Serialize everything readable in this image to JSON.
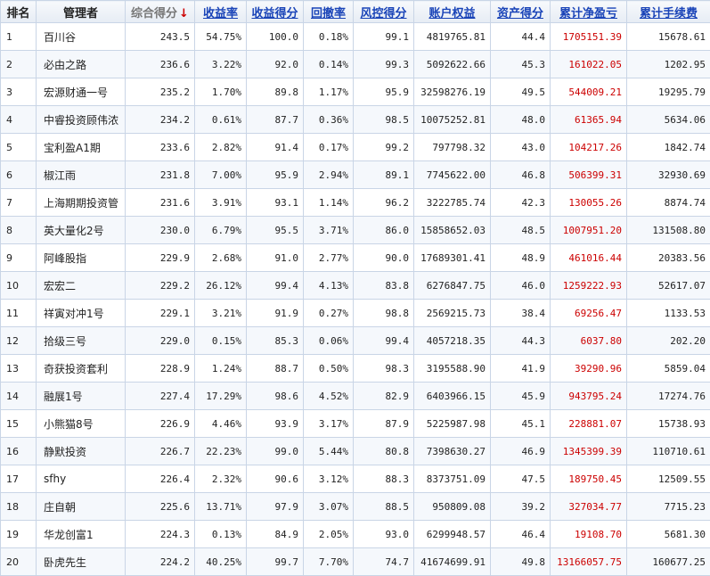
{
  "headers": {
    "rank": "排名",
    "manager": "管理者",
    "composite": "综合得分",
    "sort_arrow": "↓",
    "return_rate": "收益率",
    "return_score": "收益得分",
    "drawdown": "回撤率",
    "risk_score": "风控得分",
    "equity": "账户权益",
    "asset_score": "资产得分",
    "cum_pnl": "累计净盈亏",
    "cum_fee": "累计手续费"
  },
  "rows": [
    {
      "rank": "1",
      "manager": "百川谷",
      "composite": "243.5",
      "return_rate": "54.75%",
      "return_score": "100.0",
      "drawdown": "0.18%",
      "risk_score": "99.1",
      "equity": "4819765.81",
      "asset_score": "44.4",
      "cum_pnl": "1705151.39",
      "cum_fee": "15678.61"
    },
    {
      "rank": "2",
      "manager": "必由之路",
      "composite": "236.6",
      "return_rate": "3.22%",
      "return_score": "92.0",
      "drawdown": "0.14%",
      "risk_score": "99.3",
      "equity": "5092622.66",
      "asset_score": "45.3",
      "cum_pnl": "161022.05",
      "cum_fee": "1202.95"
    },
    {
      "rank": "3",
      "manager": "宏源财通一号",
      "composite": "235.2",
      "return_rate": "1.70%",
      "return_score": "89.8",
      "drawdown": "1.17%",
      "risk_score": "95.9",
      "equity": "32598276.19",
      "asset_score": "49.5",
      "cum_pnl": "544009.21",
      "cum_fee": "19295.79"
    },
    {
      "rank": "4",
      "manager": "中睿投资顾伟浓",
      "composite": "234.2",
      "return_rate": "0.61%",
      "return_score": "87.7",
      "drawdown": "0.36%",
      "risk_score": "98.5",
      "equity": "10075252.81",
      "asset_score": "48.0",
      "cum_pnl": "61365.94",
      "cum_fee": "5634.06"
    },
    {
      "rank": "5",
      "manager": "宝利盈A1期",
      "composite": "233.6",
      "return_rate": "2.82%",
      "return_score": "91.4",
      "drawdown": "0.17%",
      "risk_score": "99.2",
      "equity": "797798.32",
      "asset_score": "43.0",
      "cum_pnl": "104217.26",
      "cum_fee": "1842.74"
    },
    {
      "rank": "6",
      "manager": "椒江雨",
      "composite": "231.8",
      "return_rate": "7.00%",
      "return_score": "95.9",
      "drawdown": "2.94%",
      "risk_score": "89.1",
      "equity": "7745622.00",
      "asset_score": "46.8",
      "cum_pnl": "506399.31",
      "cum_fee": "32930.69"
    },
    {
      "rank": "7",
      "manager": "上海期期投资管",
      "composite": "231.6",
      "return_rate": "3.91%",
      "return_score": "93.1",
      "drawdown": "1.14%",
      "risk_score": "96.2",
      "equity": "3222785.74",
      "asset_score": "42.3",
      "cum_pnl": "130055.26",
      "cum_fee": "8874.74"
    },
    {
      "rank": "8",
      "manager": "英大量化2号",
      "composite": "230.0",
      "return_rate": "6.79%",
      "return_score": "95.5",
      "drawdown": "3.71%",
      "risk_score": "86.0",
      "equity": "15858652.03",
      "asset_score": "48.5",
      "cum_pnl": "1007951.20",
      "cum_fee": "131508.80"
    },
    {
      "rank": "9",
      "manager": "阿峰股指",
      "composite": "229.9",
      "return_rate": "2.68%",
      "return_score": "91.0",
      "drawdown": "2.77%",
      "risk_score": "90.0",
      "equity": "17689301.41",
      "asset_score": "48.9",
      "cum_pnl": "461016.44",
      "cum_fee": "20383.56"
    },
    {
      "rank": "10",
      "manager": "宏宏二",
      "composite": "229.2",
      "return_rate": "26.12%",
      "return_score": "99.4",
      "drawdown": "4.13%",
      "risk_score": "83.8",
      "equity": "6276847.75",
      "asset_score": "46.0",
      "cum_pnl": "1259222.93",
      "cum_fee": "52617.07"
    },
    {
      "rank": "11",
      "manager": "祥寅对冲1号",
      "composite": "229.1",
      "return_rate": "3.21%",
      "return_score": "91.9",
      "drawdown": "0.27%",
      "risk_score": "98.8",
      "equity": "2569215.73",
      "asset_score": "38.4",
      "cum_pnl": "69256.47",
      "cum_fee": "1133.53"
    },
    {
      "rank": "12",
      "manager": "拾级三号",
      "composite": "229.0",
      "return_rate": "0.15%",
      "return_score": "85.3",
      "drawdown": "0.06%",
      "risk_score": "99.4",
      "equity": "4057218.35",
      "asset_score": "44.3",
      "cum_pnl": "6037.80",
      "cum_fee": "202.20"
    },
    {
      "rank": "13",
      "manager": "奇获投资套利",
      "composite": "228.9",
      "return_rate": "1.24%",
      "return_score": "88.7",
      "drawdown": "0.50%",
      "risk_score": "98.3",
      "equity": "3195588.90",
      "asset_score": "41.9",
      "cum_pnl": "39290.96",
      "cum_fee": "5859.04"
    },
    {
      "rank": "14",
      "manager": "融展1号",
      "composite": "227.4",
      "return_rate": "17.29%",
      "return_score": "98.6",
      "drawdown": "4.52%",
      "risk_score": "82.9",
      "equity": "6403966.15",
      "asset_score": "45.9",
      "cum_pnl": "943795.24",
      "cum_fee": "17274.76"
    },
    {
      "rank": "15",
      "manager": "小熊猫8号",
      "composite": "226.9",
      "return_rate": "4.46%",
      "return_score": "93.9",
      "drawdown": "3.17%",
      "risk_score": "87.9",
      "equity": "5225987.98",
      "asset_score": "45.1",
      "cum_pnl": "228881.07",
      "cum_fee": "15738.93"
    },
    {
      "rank": "16",
      "manager": "静默投资",
      "composite": "226.7",
      "return_rate": "22.23%",
      "return_score": "99.0",
      "drawdown": "5.44%",
      "risk_score": "80.8",
      "equity": "7398630.27",
      "asset_score": "46.9",
      "cum_pnl": "1345399.39",
      "cum_fee": "110710.61"
    },
    {
      "rank": "17",
      "manager": "sfhy",
      "composite": "226.4",
      "return_rate": "2.32%",
      "return_score": "90.6",
      "drawdown": "3.12%",
      "risk_score": "88.3",
      "equity": "8373751.09",
      "asset_score": "47.5",
      "cum_pnl": "189750.45",
      "cum_fee": "12509.55"
    },
    {
      "rank": "18",
      "manager": "庄自朝",
      "composite": "225.6",
      "return_rate": "13.71%",
      "return_score": "97.9",
      "drawdown": "3.07%",
      "risk_score": "88.5",
      "equity": "950809.08",
      "asset_score": "39.2",
      "cum_pnl": "327034.77",
      "cum_fee": "7715.23"
    },
    {
      "rank": "19",
      "manager": "华龙创富1",
      "composite": "224.3",
      "return_rate": "0.13%",
      "return_score": "84.9",
      "drawdown": "2.05%",
      "risk_score": "93.0",
      "equity": "6299948.57",
      "asset_score": "46.4",
      "cum_pnl": "19108.70",
      "cum_fee": "5681.30"
    },
    {
      "rank": "20",
      "manager": "卧虎先生",
      "composite": "224.2",
      "return_rate": "40.25%",
      "return_score": "99.7",
      "drawdown": "7.70%",
      "risk_score": "74.7",
      "equity": "41674699.91",
      "asset_score": "49.8",
      "cum_pnl": "13166057.75",
      "cum_fee": "160677.25"
    }
  ]
}
